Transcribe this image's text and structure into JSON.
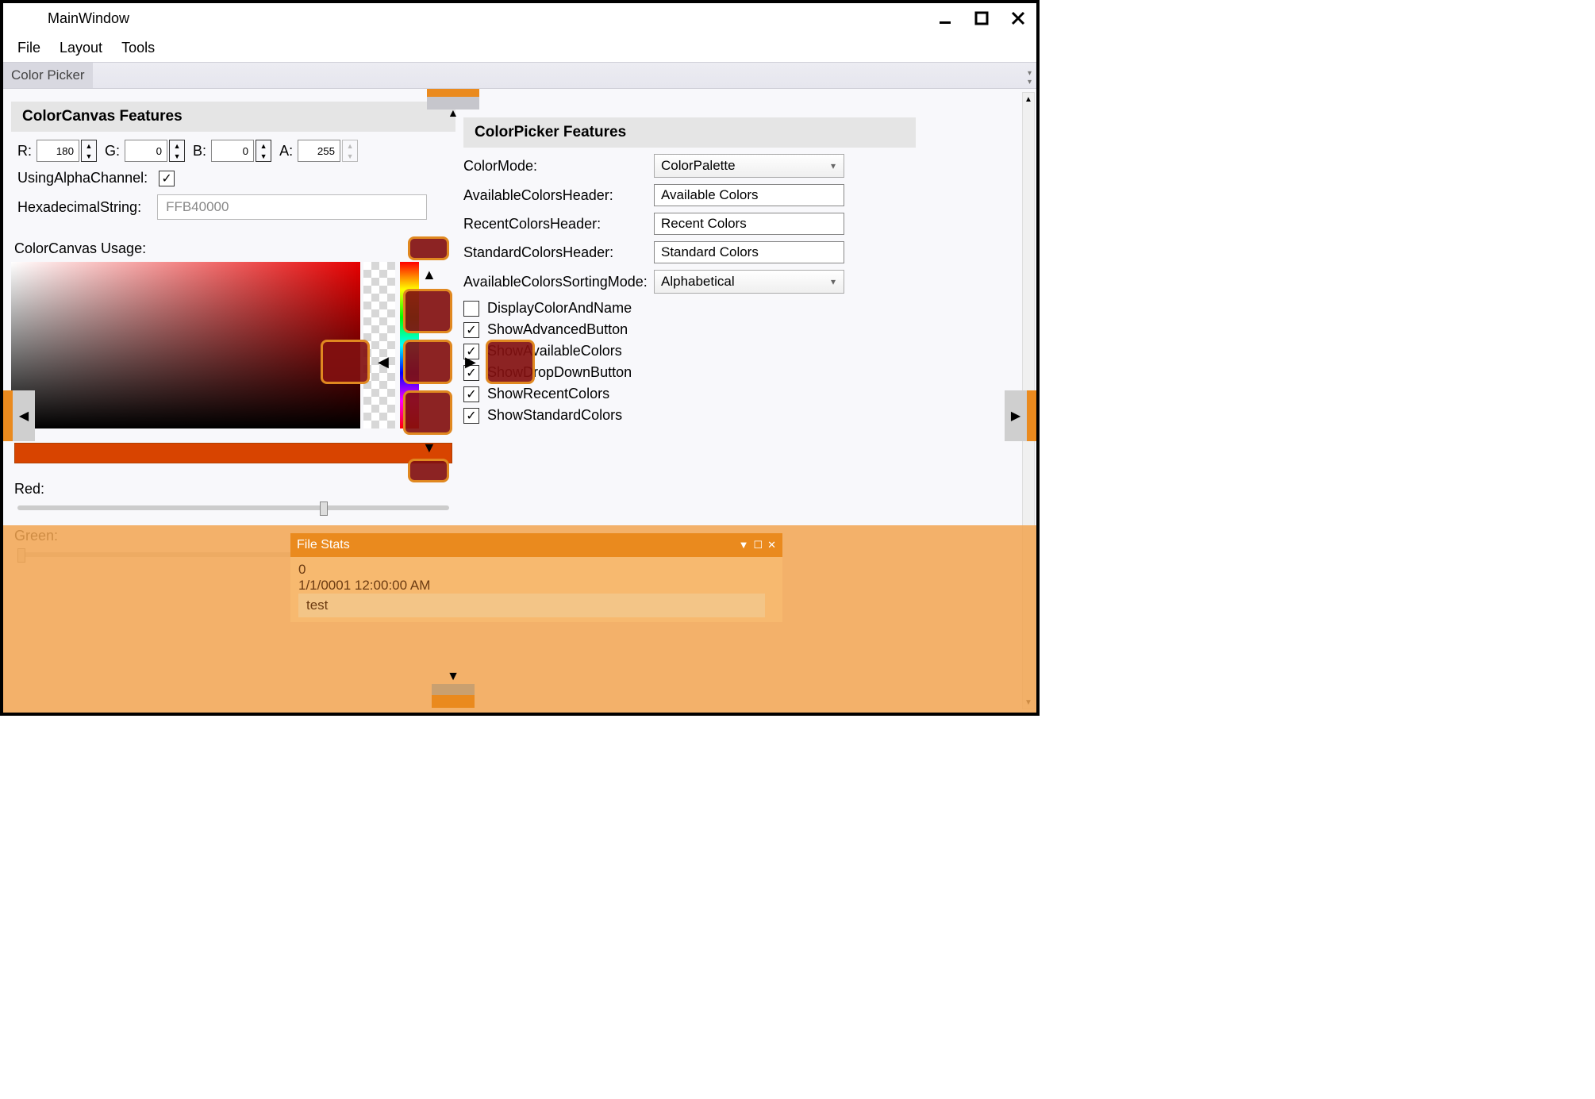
{
  "window": {
    "title": "MainWindow"
  },
  "menubar": {
    "items": [
      "File",
      "Layout",
      "Tools"
    ]
  },
  "tab": {
    "label": "Color Picker"
  },
  "left": {
    "title": "ColorCanvas Features",
    "rgba_labels": {
      "r": "R:",
      "g": "G:",
      "b": "B:",
      "a": "A:"
    },
    "r": "180",
    "g": "0",
    "b": "0",
    "a": "255",
    "alpha_label": "UsingAlphaChannel:",
    "alpha_checked": true,
    "hex_label": "HexadecimalString:",
    "hex_value": "FFB40000",
    "usage_label": "ColorCanvas Usage:",
    "red_label": "Red:",
    "green_label": "Green:"
  },
  "right": {
    "title": "ColorPicker Features",
    "rows": {
      "colormode_lbl": "ColorMode:",
      "colormode_val": "ColorPalette",
      "avail_lbl": "AvailableColorsHeader:",
      "avail_val": "Available Colors",
      "recent_lbl": "RecentColorsHeader:",
      "recent_val": "Recent Colors",
      "standard_lbl": "StandardColorsHeader:",
      "standard_val": "Standard Colors",
      "sort_lbl": "AvailableColorsSortingMode:",
      "sort_val": "Alphabetical"
    },
    "checks": {
      "display": "DisplayColorAndName",
      "adv": "ShowAdvancedButton",
      "avail": "ShowAvailableColors",
      "drop": "ShowDropDownButton",
      "recent": "ShowRecentColors",
      "standard": "ShowStandardColors"
    }
  },
  "filestats": {
    "title": "File Stats",
    "line1": "0",
    "line2": "1/1/0001 12:00:00 AM",
    "input": "test"
  }
}
